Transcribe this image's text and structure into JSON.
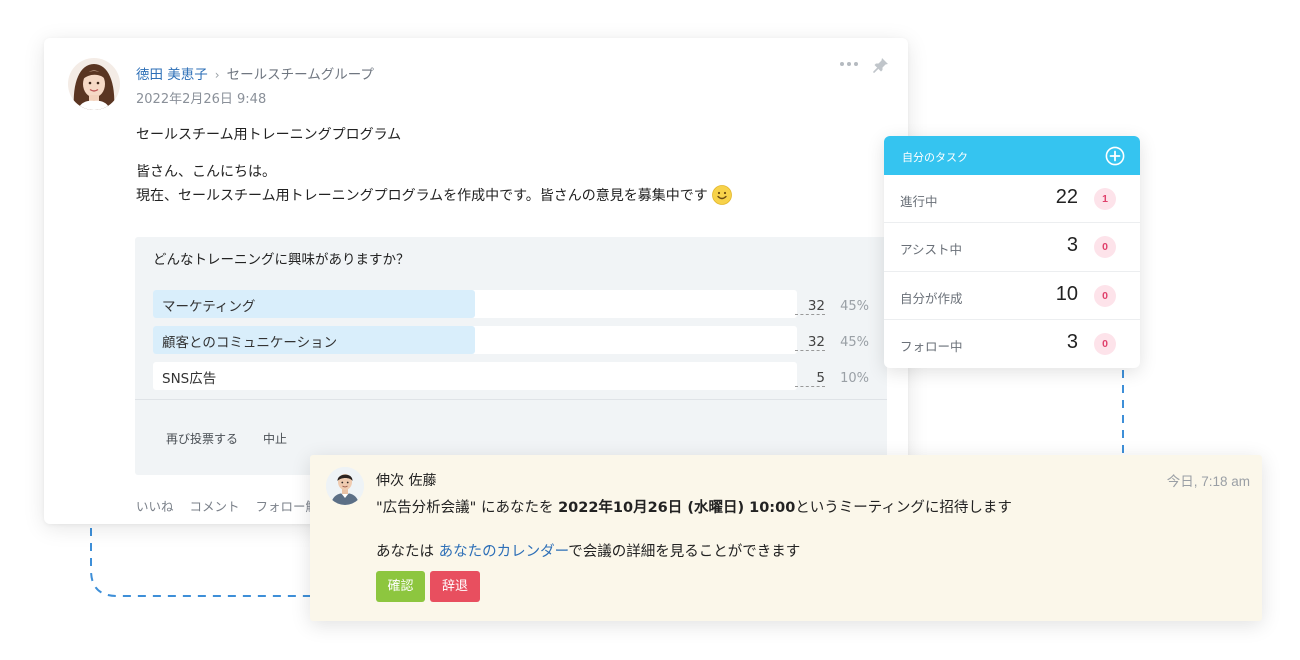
{
  "post": {
    "author": "徳田 美恵子",
    "group": "セールスチームグループ",
    "date": "2022年2月26日 9:48",
    "title": "セールスチーム用トレーニングプログラム",
    "body_line1": "皆さん、こんにちは。",
    "body_line2": "現在、セールスチーム用トレーニングプログラムを作成中です。皆さんの意見を募集中です",
    "icons": {
      "more": "more-dots-icon",
      "pin": "pin-icon",
      "emoji": "smile-emoji-icon",
      "chevron": "chevron-right-icon"
    },
    "poll": {
      "question": "どんなトレーニングに興味がありますか？",
      "options": [
        {
          "label": "マーケティング",
          "count": "32",
          "percent": "45%",
          "fill": 0.5
        },
        {
          "label": "顧客とのコミュニケーション",
          "count": "32",
          "percent": "45%",
          "fill": 0.5
        },
        {
          "label": "SNS広告",
          "count": "5",
          "percent": "10%",
          "fill": 0
        }
      ],
      "revote_label": "再び投票する",
      "stop_label": "中止"
    },
    "actions": {
      "like": "いいね",
      "comment": "コメント",
      "follow": "フォロー解"
    }
  },
  "tasks": {
    "title": "自分のタスク",
    "header_color": "#35c4f0",
    "items": [
      {
        "label": "進行中",
        "count": "22",
        "badge": "1"
      },
      {
        "label": "アシスト中",
        "count": "3",
        "badge": "0"
      },
      {
        "label": "自分が作成",
        "count": "10",
        "badge": "0"
      },
      {
        "label": "フォロー中",
        "count": "3",
        "badge": "0"
      }
    ]
  },
  "notification": {
    "author": "伸次 佐藤",
    "time": "今日, 7:18 am",
    "msg_pre": "\"広告分析会議\" にあなたを ",
    "msg_date": "2022年10月26日 (水曜日) 10:00",
    "msg_post": "というミーティングに招待します",
    "line2_pre": "あなたは ",
    "line2_link": "あなたのカレンダー",
    "line2_post": "で会議の詳細を見ることができます",
    "confirm_label": "確認",
    "decline_label": "辞退",
    "confirm_color": "#8dc63f",
    "decline_color": "#e84f5f"
  }
}
